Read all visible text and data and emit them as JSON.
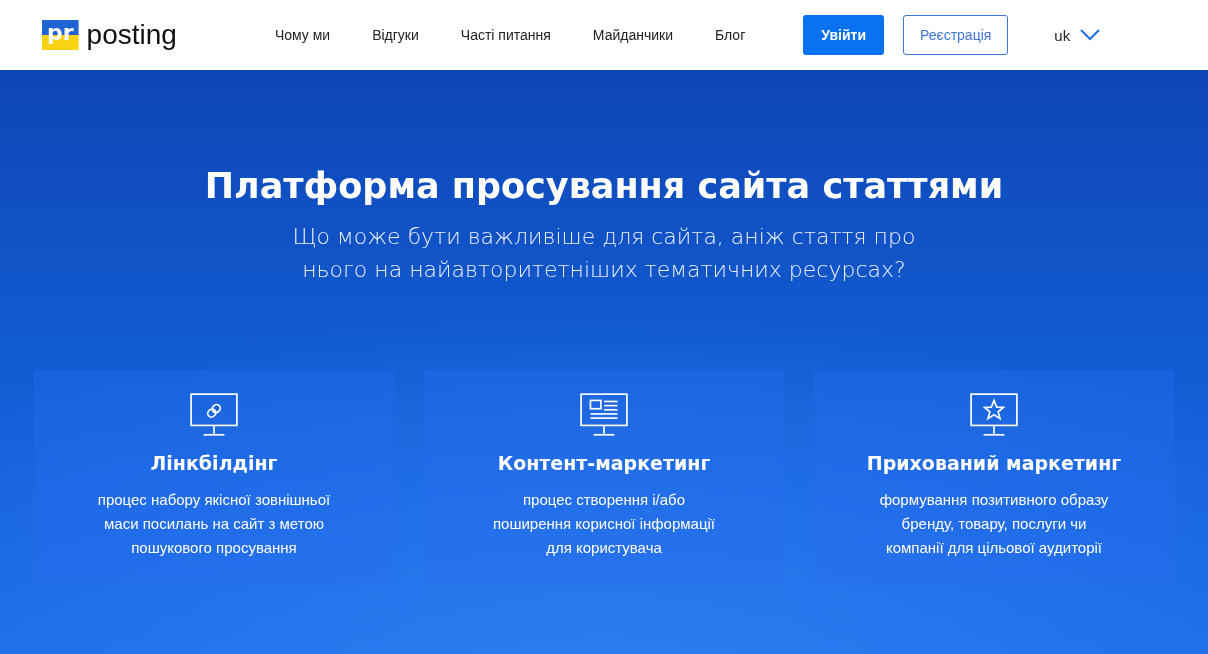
{
  "header": {
    "logo": {
      "mark": "pr",
      "name": "posting"
    },
    "nav": [
      {
        "label": "Чому ми"
      },
      {
        "label": "Відгуки"
      },
      {
        "label": "Часті питання"
      },
      {
        "label": "Майданчики"
      },
      {
        "label": "Блог"
      }
    ],
    "login_button": "Увійти",
    "register_button": "Реєстрація",
    "language": "uk"
  },
  "hero": {
    "title": "Платформа просування сайта статтями",
    "subtitle_lines": [
      "Що може бути важливіше для сайта, аніж стаття про",
      "нього на найавторитетніших тематичних ресурсах?"
    ]
  },
  "features": [
    {
      "kind": "link",
      "title": "Лінкбілдінг",
      "description_lines": [
        "процес набору якісної зовнішньої",
        "маси посилань на сайт з метою",
        "пошукового просування"
      ]
    },
    {
      "kind": "article",
      "title": "Контент-маркетинг",
      "description_lines": [
        "процес створення і/або",
        "поширення корисної інформації",
        "для користувача"
      ]
    },
    {
      "kind": "star",
      "title": "Прихований маркетинг",
      "description_lines": [
        "формування позитивного образу",
        "бренду, товару, послуги чи",
        "компанії для цільової аудиторії"
      ]
    }
  ]
}
